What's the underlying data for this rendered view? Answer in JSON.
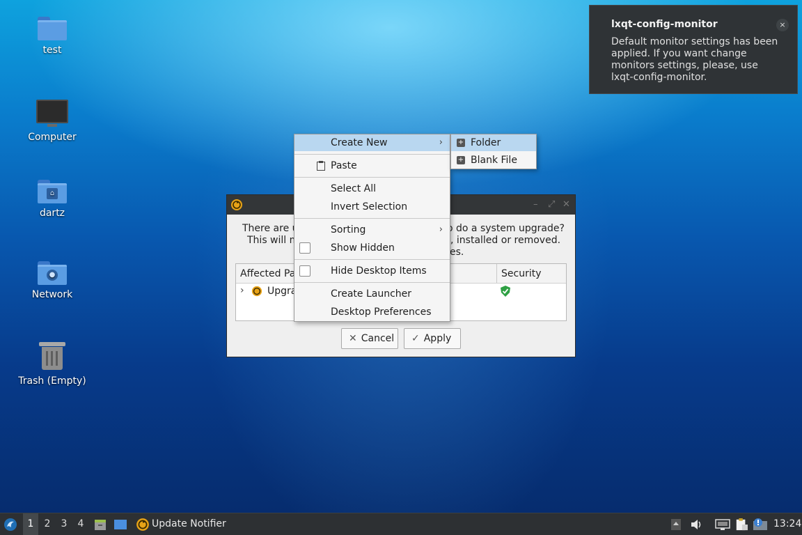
{
  "desktop": {
    "icons": [
      {
        "label": "test",
        "icon": "folder-icon"
      },
      {
        "label": "Computer",
        "icon": "computer-icon"
      },
      {
        "label": "dartz",
        "icon": "home-folder-icon"
      },
      {
        "label": "Network",
        "icon": "network-folder-icon"
      },
      {
        "label": "Trash (Empty)",
        "icon": "trash-icon"
      }
    ]
  },
  "notification": {
    "title": "lxqt-config-monitor",
    "body": "Default monitor settings has been applied. If you want change monitors settings, please, use lxqt-config-monitor.",
    "close_glyph": "×"
  },
  "dialog": {
    "message_line1": "There are u",
    "message_line1_end": "o do a system upgrade?",
    "message_line2": "This will m",
    "message_line2_end": ", installed or removed.",
    "message_line3_end": "es.",
    "columns": [
      "Affected Pa",
      "Security"
    ],
    "row": {
      "expander": "›",
      "label": "Upgra"
    },
    "cancel_label": "Cancel",
    "apply_label": "Apply",
    "cancel_glyph": "✕",
    "apply_glyph": "✓"
  },
  "context_menu": {
    "items": [
      {
        "label": "Create New",
        "submenu": true
      },
      {
        "label": "Paste"
      },
      {
        "label": "Select All"
      },
      {
        "label": "Invert Selection"
      },
      {
        "label": "Sorting",
        "submenu": true
      },
      {
        "label": "Show Hidden",
        "checked": false
      },
      {
        "label": "Hide Desktop Items",
        "checked": false
      },
      {
        "label": "Create Launcher"
      },
      {
        "label": "Desktop Preferences"
      }
    ],
    "arrow_glyph": "›"
  },
  "submenu": {
    "items": [
      {
        "label": "Folder"
      },
      {
        "label": "Blank File"
      }
    ]
  },
  "taskbar": {
    "workspaces": [
      "1",
      "2",
      "3",
      "4"
    ],
    "active_workspace": "1",
    "task_label": "Update Notifier",
    "clock": "13:24"
  },
  "colors": {
    "menu_highlight": "#b9d7f0",
    "notify_bg": "#2f3336",
    "taskbar_bg": "#2d3033",
    "accent_orange": "#e8a317",
    "shield_green": "#2ea043"
  }
}
